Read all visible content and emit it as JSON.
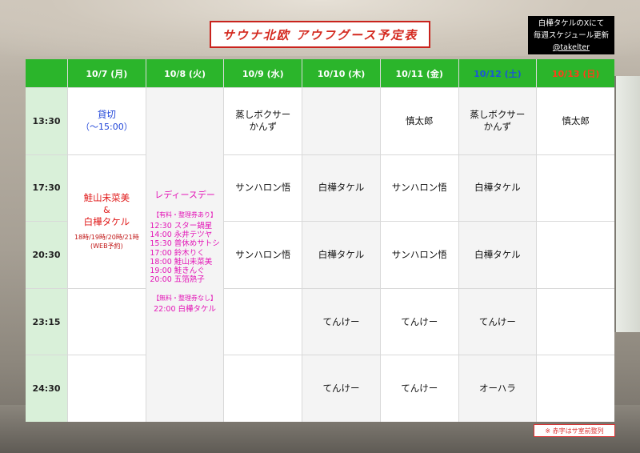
{
  "title": "サウナ北欧 アウフグース予定表",
  "info": {
    "line1": "白樺タケルのXにて",
    "line2": "毎週スケジュール更新",
    "handle": "@takelter"
  },
  "days": [
    "10/7 (月)",
    "10/8 (火)",
    "10/9 (水)",
    "10/10 (木)",
    "10/11 (金)",
    "10/12 (土)",
    "10/13 (日)"
  ],
  "times": [
    "13:30",
    "17:30",
    "20:30",
    "23:15",
    "24:30"
  ],
  "mon": {
    "kashikiri": "貸切",
    "kashikiri_sub": "（〜15:00）",
    "name1": "鮭山未菜美",
    "amp": "&",
    "name2": "白樺タケル",
    "times": "18時/19時/20時/21時",
    "web": "(WEB予約)"
  },
  "tue": {
    "title": "レディースデー",
    "paid_tag": "【有料・整理券あり】",
    "paid": [
      "12:30 スター鍋星",
      "14:00 永井テツヤ",
      "15:30 普休めサトシ",
      "17:00 鈴木りく",
      "18:00 鮭山未菜美",
      "19:00 鮭きんぐ",
      "20:00 五箔熱子"
    ],
    "free_tag": "【無料・整理券なし】",
    "free": [
      "22:00 白樺タケル"
    ]
  },
  "cells": {
    "wed_1330": "蒸しボクサー\nかんず",
    "fri_1330": "慎太郎",
    "sat_1330": "蒸しボクサー\nかんず",
    "sun_1330": "慎太郎",
    "wed_1730": "サンハロン悟",
    "thu_1730": "白樺タケル",
    "fri_1730": "サンハロン悟",
    "sat_1730": "白樺タケル",
    "wed_2030": "サンハロン悟",
    "thu_2030": "白樺タケル",
    "fri_2030": "サンハロン悟",
    "sat_2030": "白樺タケル",
    "thu_2315": "てんけー",
    "fri_2315": "てんけー",
    "sat_2315": "てんけー",
    "thu_2430": "てんけー",
    "fri_2430": "てんけー",
    "sat_2430": "オーハラ"
  },
  "note": "※ 赤字はサ室前整列",
  "colors": {
    "header": "#2bb52b",
    "time_col": "#d9f0d9",
    "saturday": "#1a55d8",
    "sunday": "#ff3d1a",
    "ladies": "#e316b7",
    "red": "#e01a1a"
  }
}
